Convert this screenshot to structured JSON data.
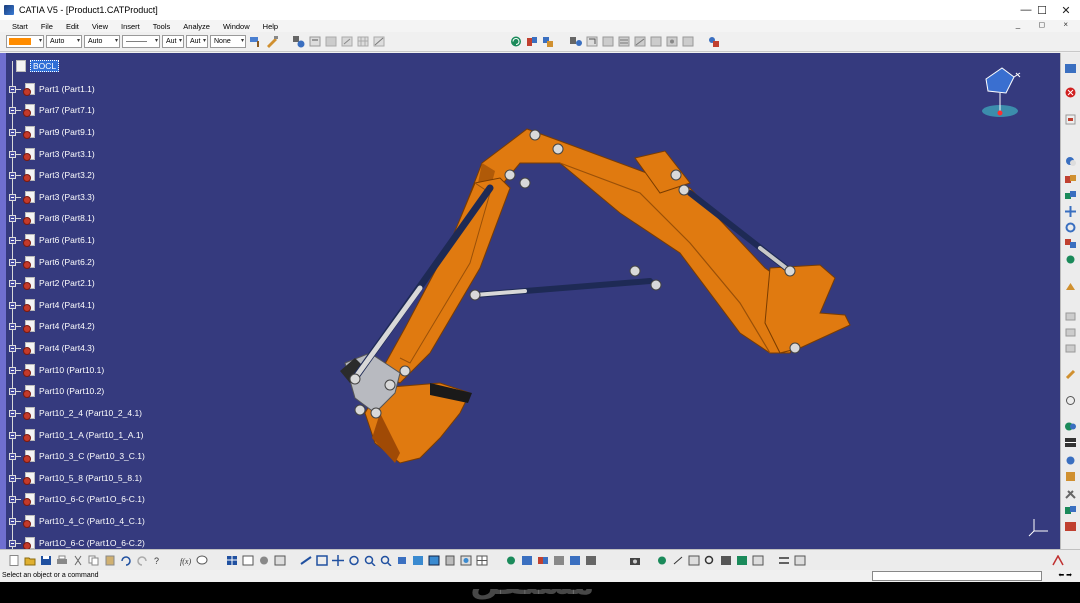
{
  "window": {
    "title": "CATIA V5 - [Product1.CATProduct]",
    "controls": {
      "minimize": "—",
      "maximize": "☐",
      "close": "✕"
    }
  },
  "menu": {
    "items": [
      "Start",
      "File",
      "Edit",
      "View",
      "Insert",
      "Tools",
      "Analyze",
      "Window",
      "Help"
    ],
    "mdi_controls": "_ ◻ ×"
  },
  "toolbar": {
    "color_value": "#ff8c00",
    "transparency_value": "Auto",
    "line_thickness_value": "Auto",
    "line_type_value": "———",
    "point_symbol_value": "Aut",
    "layer_value": "Aut",
    "render_value": "None"
  },
  "tree": {
    "root_label": "BOCL",
    "items": [
      "Part1 (Part1.1)",
      "Part7 (Part7.1)",
      "Part9 (Part9.1)",
      "Part3 (Part3.1)",
      "Part3 (Part3.2)",
      "Part3 (Part3.3)",
      "Part8 (Part8.1)",
      "Part6 (Part6.1)",
      "Part6 (Part6.2)",
      "Part2 (Part2.1)",
      "Part4 (Part4.1)",
      "Part4 (Part4.2)",
      "Part4 (Part4.3)",
      "Part10 (Part10.1)",
      "Part10 (Part10.2)",
      "Part10_2_4 (Part10_2_4.1)",
      "Part10_1_A (Part10_1_A.1)",
      "Part10_3_C (Part10_3_C.1)",
      "Part10_5_8 (Part10_5_8.1)",
      "Part1O_6-C (Part1O_6-C.1)",
      "Part10_4_C (Part10_4_C.1)",
      "Part1O_6-C (Part1O_6-C.2)"
    ]
  },
  "status": {
    "message": "Select an object or a command",
    "arrows": "⬅ ➡"
  },
  "watermark": {
    "text": "مستقل"
  },
  "colors": {
    "viewport_bg": "#353a7e",
    "model_orange": "#e07a10",
    "selection_blue": "#2f6fd6"
  }
}
